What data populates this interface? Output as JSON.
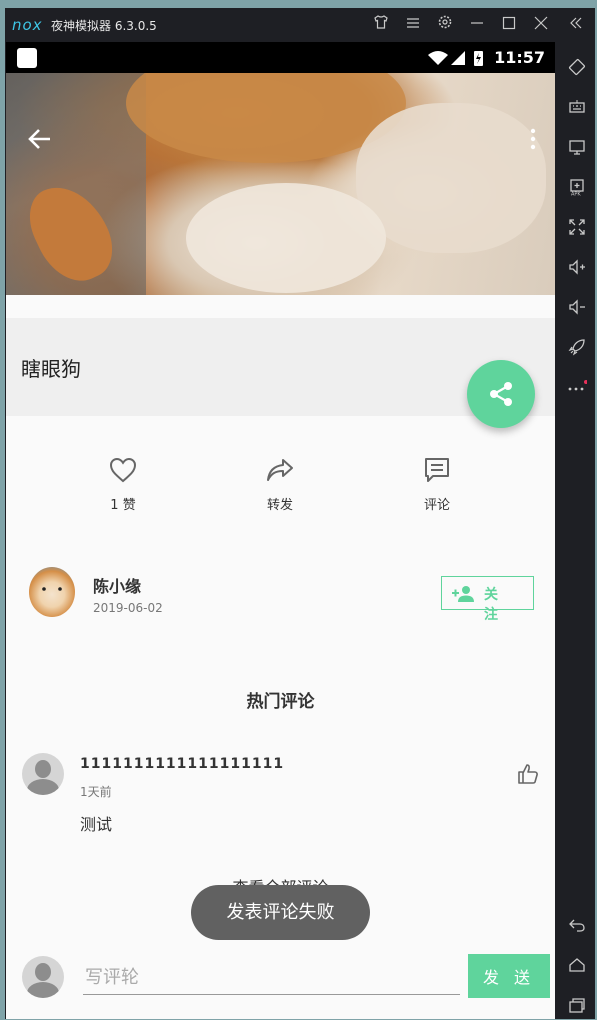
{
  "emulator": {
    "logo": "nox",
    "title": "夜神模拟器 6.3.0.5",
    "titlebar_icons": [
      "shirt-icon",
      "menu-icon",
      "settings-icon",
      "minimize-icon",
      "maximize-icon",
      "close-icon",
      "collapse-icon"
    ],
    "sidebar_icons": [
      "rotate-icon",
      "keyboard-icon",
      "screen-icon",
      "apk-icon",
      "fullscreen-icon",
      "volume-up-icon",
      "volume-down-icon",
      "rocket-icon",
      "more-icon",
      "back-icon",
      "home-icon",
      "recents-icon"
    ]
  },
  "statusbar": {
    "time": "11:57"
  },
  "post": {
    "title": "瞎眼狗"
  },
  "actions": {
    "like_label": "1 赞",
    "share_label": "转发",
    "comment_label": "评论"
  },
  "author": {
    "name": "陈小缘",
    "date": "2019-06-02",
    "follow_label": "关 注"
  },
  "comments_section": {
    "title": "热门评论",
    "comments": [
      {
        "user": "1111111111111111111",
        "time": "1天前",
        "text": "测试"
      }
    ],
    "view_all_label": "查看全部评论"
  },
  "toast": {
    "message": "发表评论失败"
  },
  "composer": {
    "placeholder": "写评轮",
    "send_label": "发 送"
  },
  "colors": {
    "accent": "#5fd49c",
    "toast_bg": "#616161",
    "status_bar": "#000000"
  }
}
